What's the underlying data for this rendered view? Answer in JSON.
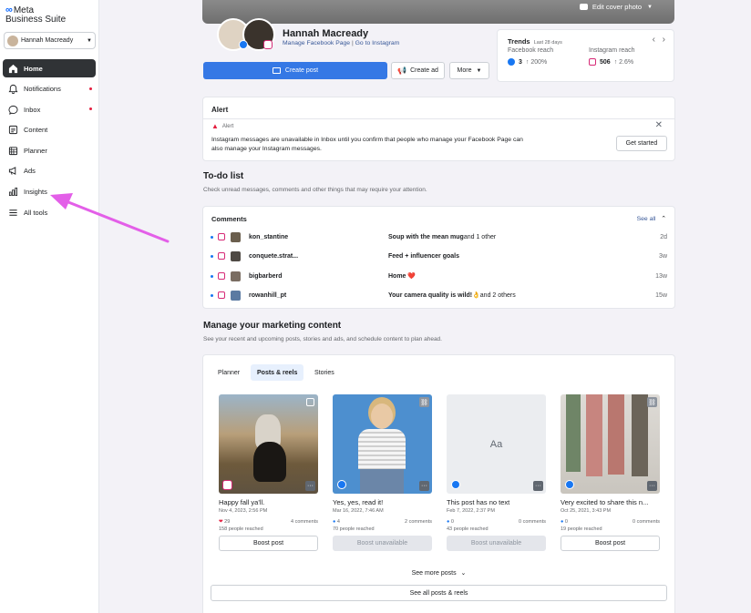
{
  "sidebar": {
    "brand": "Meta",
    "product": "Business Suite",
    "account": "Hannah Macready",
    "items": [
      {
        "label": "Home",
        "active": true,
        "dot": false
      },
      {
        "label": "Notifications",
        "active": false,
        "dot": true
      },
      {
        "label": "Inbox",
        "active": false,
        "dot": true
      },
      {
        "label": "Content",
        "active": false,
        "dot": false
      },
      {
        "label": "Planner",
        "active": false,
        "dot": false
      },
      {
        "label": "Ads",
        "active": false,
        "dot": false
      },
      {
        "label": "Insights",
        "active": false,
        "dot": false
      },
      {
        "label": "All tools",
        "active": false,
        "dot": false
      }
    ]
  },
  "cover": {
    "edit_label": "Edit cover photo"
  },
  "profile": {
    "name": "Hannah Macready",
    "manage_fb": "Manage Facebook Page",
    "sep": "|",
    "go_ig": "Go to Instagram",
    "create_post": "Create post",
    "create_ad": "Create ad",
    "more": "More"
  },
  "trends": {
    "title": "Trends",
    "period": "Last 28 days",
    "fb_label": "Facebook reach",
    "fb_value": "3",
    "fb_change": "↑ 200%",
    "ig_label": "Instagram reach",
    "ig_value": "506",
    "ig_change": "↑ 2.6%"
  },
  "alert": {
    "title": "Alert",
    "kind": "Alert",
    "message": "Instagram messages are unavailable in Inbox until you confirm that people who manage your Facebook Page can also manage your Instagram messages.",
    "cta": "Get started"
  },
  "todo": {
    "title": "To-do list",
    "subtitle": "Check unread messages, comments and other things that may require your attention."
  },
  "comments": {
    "title": "Comments",
    "see_all": "See all",
    "rows": [
      {
        "user": "kon_stantine",
        "post": "Soup with the mean mug",
        "extra": " and 1 other",
        "time": "2d",
        "thumb": "#6b5f4e"
      },
      {
        "user": "conquete.strat...",
        "post": "Feed + influencer goals",
        "extra": "",
        "time": "3w",
        "thumb": "#4f4a44"
      },
      {
        "user": "bigbarberd",
        "post": "Home ❤️",
        "extra": "",
        "time": "13w",
        "thumb": "#7a6d62"
      },
      {
        "user": "rowanhill_pt",
        "post": "Your camera quality is wild!👌",
        "extra": " and 2 others",
        "time": "15w",
        "thumb": "#5b7aa2"
      }
    ]
  },
  "marketing": {
    "title": "Manage your marketing content",
    "subtitle": "See your recent and upcoming posts, stories and ads, and schedule content to plan ahead.",
    "tabs": [
      "Planner",
      "Posts & reels",
      "Stories"
    ],
    "active_tab": 1,
    "see_more": "See more posts",
    "see_all": "See all posts & reels"
  },
  "posts": [
    {
      "caption": "Happy fall ya'll.",
      "date": "Nov 4, 2023, 2:56 PM",
      "reactions": "29",
      "comments": "4 comments",
      "reach": "158 people reached",
      "boost": "Boost post",
      "boost_disabled": false,
      "platform": "instagram",
      "placeholder": ""
    },
    {
      "caption": "Yes, yes, read it!",
      "date": "Mar 16, 2022, 7:46 AM",
      "reactions": "4",
      "comments": "2 comments",
      "reach": "70 people reached",
      "boost": "Boost unavailable",
      "boost_disabled": true,
      "platform": "facebook",
      "placeholder": ""
    },
    {
      "caption": "This post has no text",
      "date": "Feb 7, 2022, 2:37 PM",
      "reactions": "0",
      "comments": "0 comments",
      "reach": "43 people reached",
      "boost": "Boost unavailable",
      "boost_disabled": true,
      "platform": "facebook",
      "placeholder": "Aa"
    },
    {
      "caption": "Very excited to share this n...",
      "date": "Oct 25, 2021, 3:43 PM",
      "reactions": "0",
      "comments": "0 comments",
      "reach": "19 people reached",
      "boost": "Boost post",
      "boost_disabled": false,
      "platform": "facebook",
      "placeholder": ""
    }
  ]
}
